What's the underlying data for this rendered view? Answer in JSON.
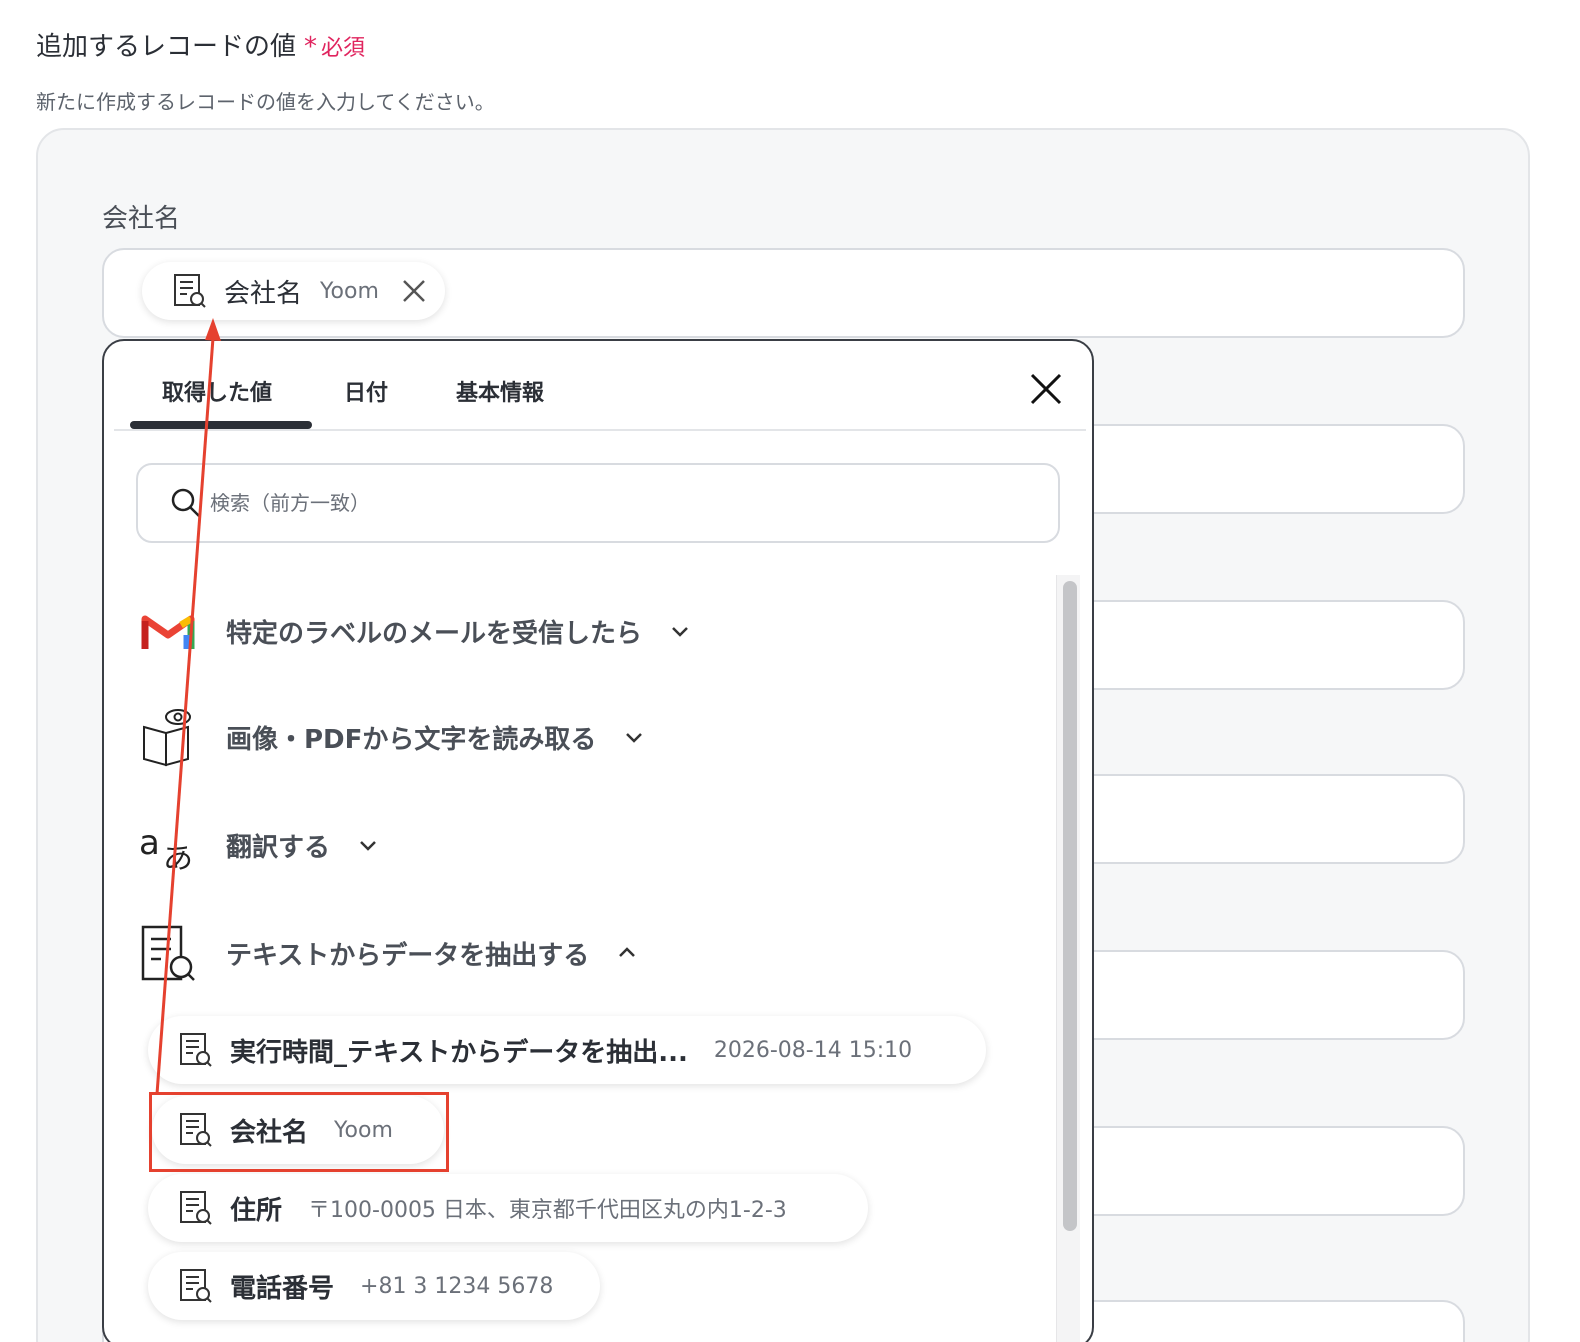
{
  "section": {
    "title": "追加するレコードの値",
    "required_mark": "*",
    "required_label": "必須",
    "description": "新たに作成するレコードの値を入力してください。"
  },
  "field": {
    "label": "会社名",
    "chip": {
      "name": "会社名",
      "value": "Yoom",
      "icon": "document-search-icon",
      "remove_icon": "close-icon"
    }
  },
  "dropdown": {
    "tabs": [
      {
        "label": "取得した値",
        "active": true
      },
      {
        "label": "日付",
        "active": false
      },
      {
        "label": "基本情報",
        "active": false
      }
    ],
    "search_placeholder": "検索（前方一致）",
    "groups": [
      {
        "label": "特定のラベルのメールを受信したら",
        "icon": "gmail-icon",
        "expanded": false
      },
      {
        "label": "画像・PDFから文字を読み取る",
        "icon": "ocr-book-icon",
        "expanded": false
      },
      {
        "label": "翻訳する",
        "icon": "translate-icon",
        "expanded": false
      },
      {
        "label": "テキストからデータを抽出する",
        "icon": "document-search-icon",
        "expanded": true
      }
    ],
    "items": [
      {
        "name": "実行時間_テキストからデータを抽出...",
        "value": "2026-08-14 15:10"
      },
      {
        "name": "会社名",
        "value": "Yoom",
        "highlighted": true
      },
      {
        "name": "住所",
        "value": "〒100-0005 日本、東京都千代田区丸の内1-2-3"
      },
      {
        "name": "電話番号",
        "value": "+81 3 1234 5678"
      }
    ]
  },
  "colors": {
    "required": "#e0245e",
    "annotation": "#e5412f",
    "panel_bg": "#f6f7f8"
  }
}
